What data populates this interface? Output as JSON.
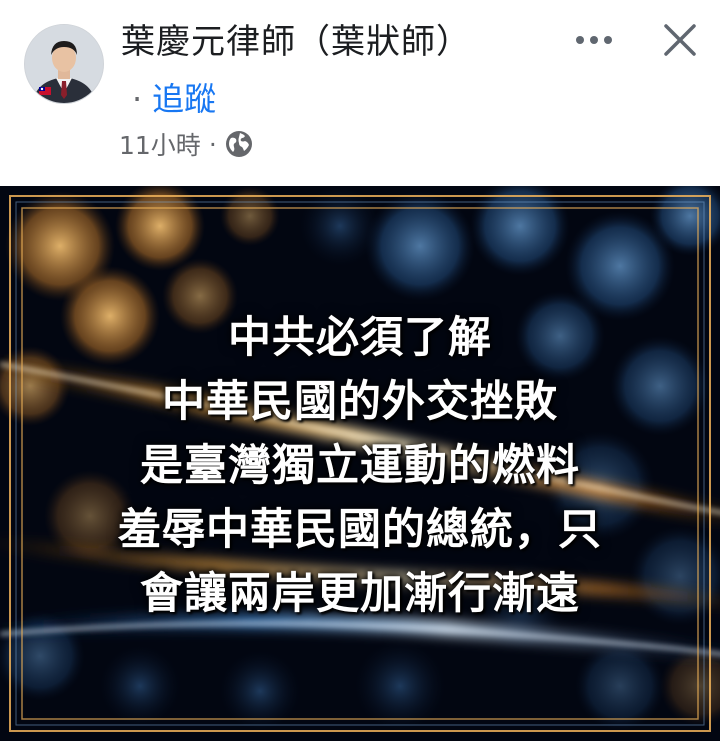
{
  "header": {
    "author_name": "葉慶元律師（葉狀師）",
    "follow_separator": "·",
    "follow_label": "追蹤",
    "timestamp": "11小時",
    "meta_separator": "·",
    "privacy_icon": "globe-icon",
    "more_icon": "more-horizontal-icon",
    "close_icon": "close-icon"
  },
  "post_image": {
    "lines": [
      "中共必須了解",
      "中華民國的外交挫敗",
      "是臺灣獨立運動的燃料",
      "羞辱中華民國的總統，只",
      "會讓兩岸更加漸行漸遠"
    ]
  },
  "colors": {
    "link": "#1877f2",
    "secondary_text": "#65676b",
    "primary_text": "#1c1e21",
    "image_background": "#020611",
    "frame_gold": "#f0b35a",
    "frame_blue": "#7fb2e5"
  }
}
